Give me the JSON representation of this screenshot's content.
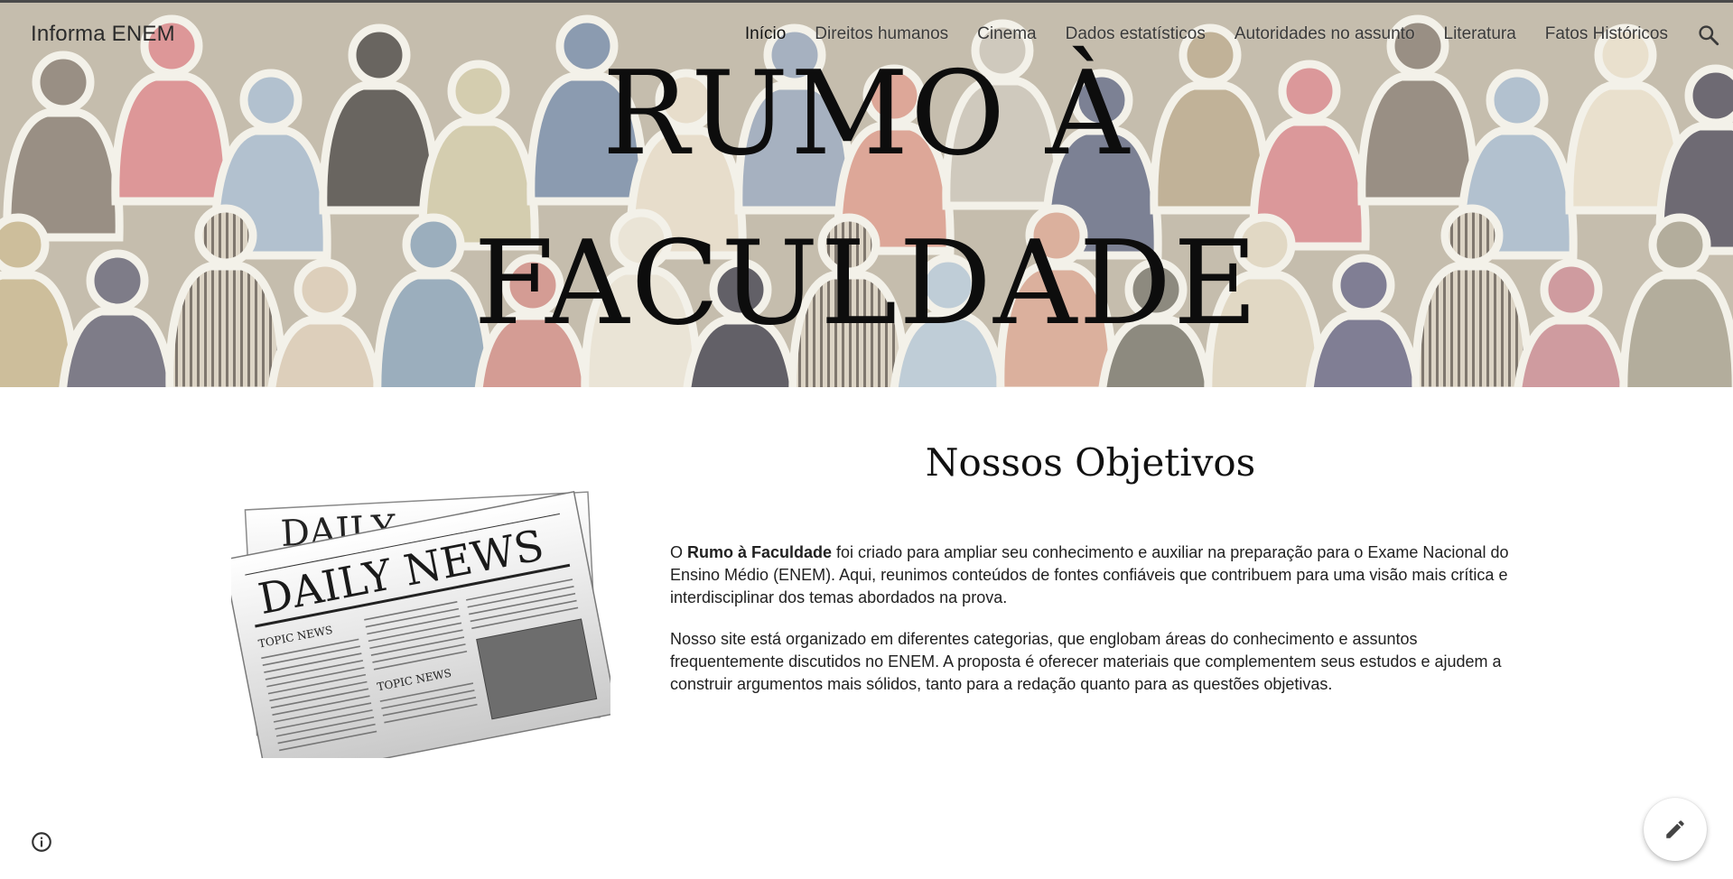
{
  "header": {
    "site_name": "Informa ENEM",
    "nav": [
      {
        "label": "Início",
        "active": true
      },
      {
        "label": "Direitos humanos",
        "active": false
      },
      {
        "label": "Cinema",
        "active": false
      },
      {
        "label": "Dados estatísticos",
        "active": false
      },
      {
        "label": "Autoridades no assunto",
        "active": false
      },
      {
        "label": "Literatura",
        "active": false
      },
      {
        "label": "Fatos Históricos",
        "active": false
      }
    ],
    "search_icon": "search-icon"
  },
  "hero": {
    "title_line1": "RUMO À",
    "title_line2": "FACULDADE"
  },
  "main": {
    "illustration": {
      "masthead": "DAILY NEWS",
      "back_masthead": "DAILY",
      "section_label_1": "TOPIC NEWS",
      "section_label_2": "TOPIC NEWS"
    },
    "heading": "Nossos Objetivos",
    "paragraph1": {
      "prefix": "O ",
      "bold": "Rumo à Faculdade",
      "rest": " foi criado para ampliar seu conhecimento e auxiliar na preparação para o Exame Nacional do Ensino Médio (ENEM). Aqui, reunimos conteúdos de fontes confiáveis que contribuem para uma visão mais crítica e interdisciplinar dos temas abordados na prova."
    },
    "paragraph2": "Nosso site está organizado em diferentes categorias, que englobam áreas do conhecimento e assuntos frequentemente discutidos no ENEM. A proposta é oferecer materiais que complementem seus estudos e ajudem a construir argumentos mais sólidos, tanto para a redação quanto para as questões objetivas."
  },
  "footer": {
    "info_icon": "info-icon",
    "edit_icon": "pencil-icon"
  },
  "colors": {
    "text": "#212121",
    "hero_base": "#b9b09e"
  }
}
